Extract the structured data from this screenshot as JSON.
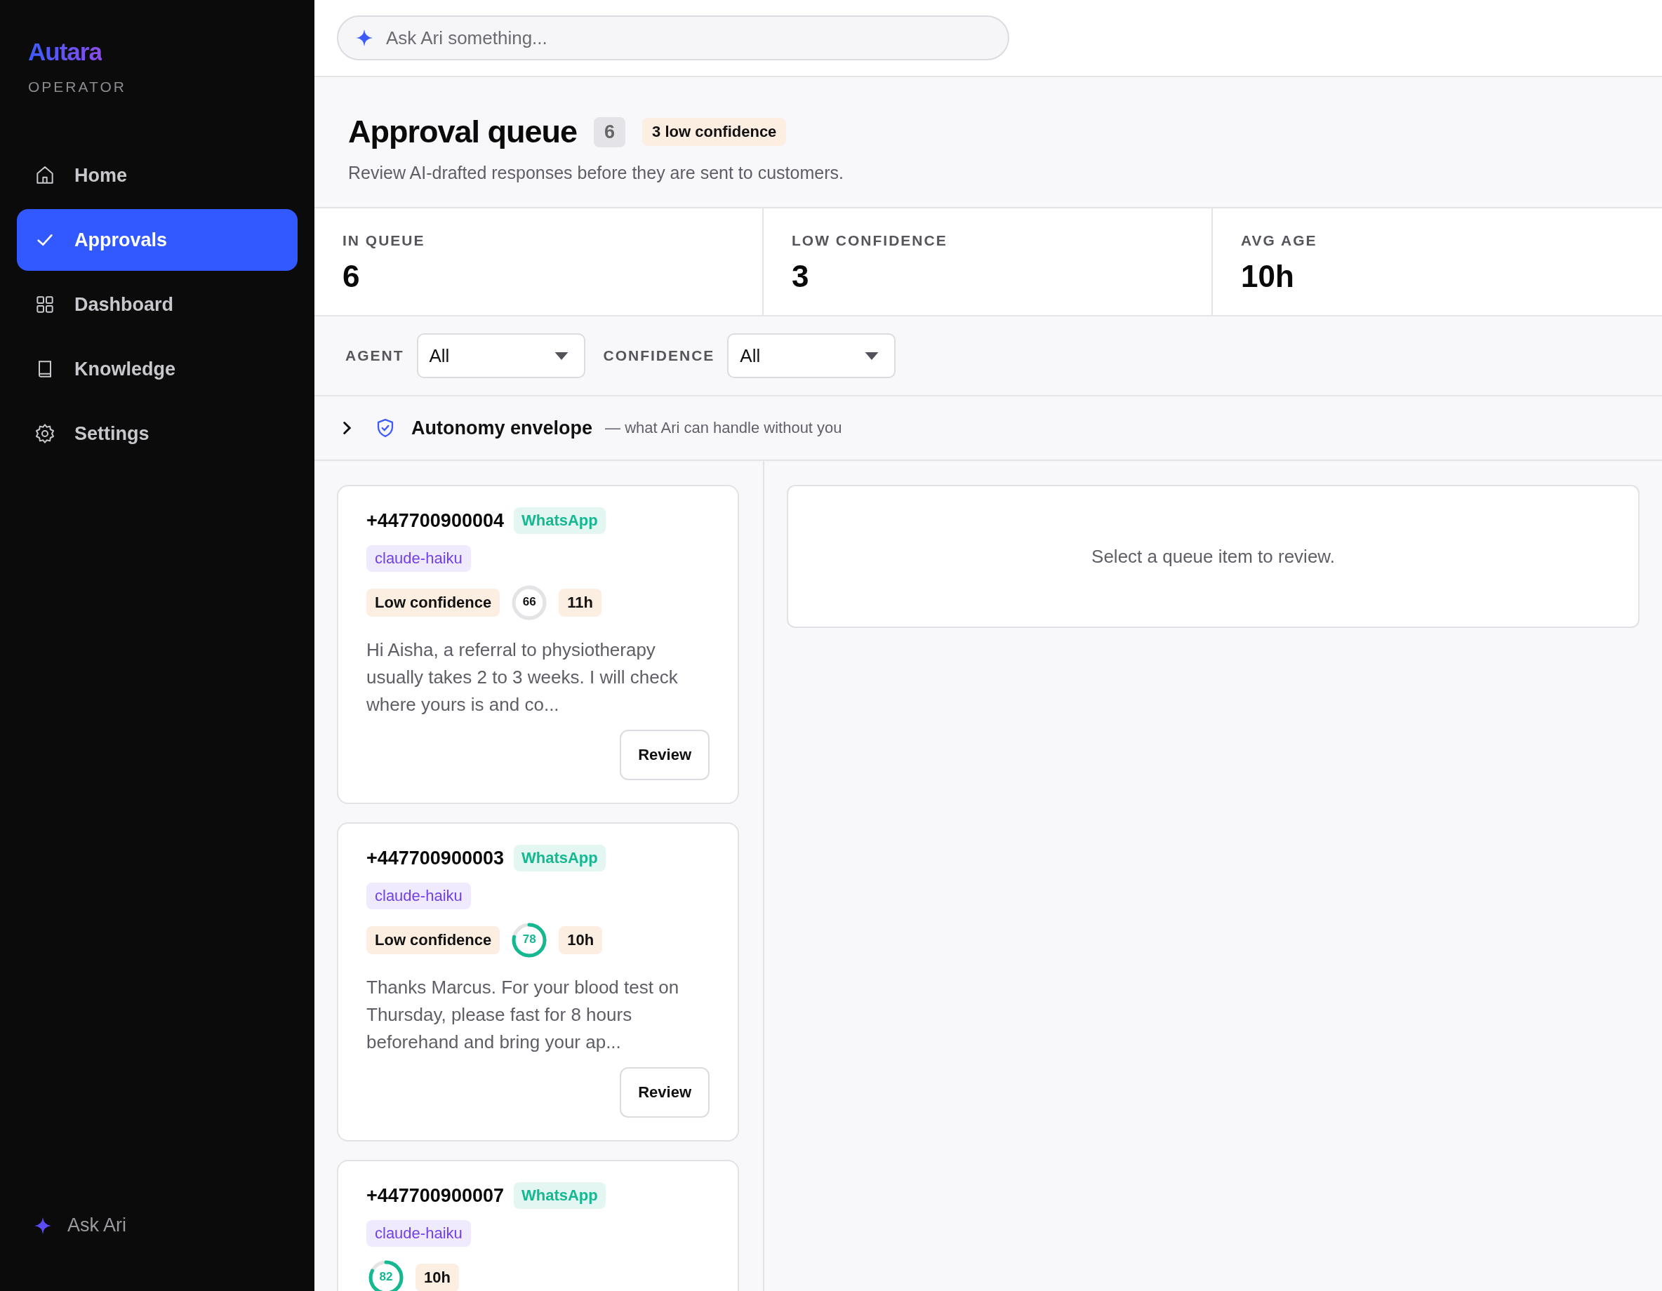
{
  "sidebar": {
    "brand": "Autara",
    "subtitle": "OPERATOR",
    "items": [
      {
        "label": "Home",
        "selected": false
      },
      {
        "label": "Approvals",
        "selected": true
      },
      {
        "label": "Dashboard",
        "selected": false
      },
      {
        "label": "Knowledge",
        "selected": false
      },
      {
        "label": "Settings",
        "selected": false
      }
    ],
    "footer": "Ask Ari"
  },
  "search": {
    "placeholder": "Ask Ari something..."
  },
  "header": {
    "title": "Approval queue",
    "count": "6",
    "badge": "3 low confidence",
    "subtitle": "Review AI-drafted responses before they are sent to customers."
  },
  "stats": [
    {
      "label": "IN QUEUE",
      "value": "6"
    },
    {
      "label": "LOW CONFIDENCE",
      "value": "3"
    },
    {
      "label": "AVG AGE",
      "value": "10h"
    }
  ],
  "filters": [
    {
      "label": "AGENT",
      "value": "All"
    },
    {
      "label": "CONFIDENCE",
      "value": "All"
    }
  ],
  "envelope": {
    "expanded": false,
    "title": "Autonomy envelope",
    "note": "— what Ari can handle without you"
  },
  "cards": [
    {
      "phone": "+447700900004",
      "channel": "WhatsApp",
      "model": "claude-haiku",
      "flag": "Low confidence",
      "score": "66",
      "color": "#e4e4e7",
      "age": "11h",
      "message": "Hi Aisha, a referral to physiotherapy usually takes 2 to 3 weeks. I will check where yours is and co...",
      "action": "Review"
    },
    {
      "phone": "+447700900003",
      "channel": "WhatsApp",
      "model": "claude-haiku",
      "flag": "Low confidence",
      "score": "78",
      "color": "#14b891",
      "age": "10h",
      "message": "Thanks Marcus. For your blood test on Thursday, please fast for 8 hours beforehand and bring your ap...",
      "action": "Review"
    },
    {
      "phone": "+447700900007",
      "channel": "WhatsApp",
      "model": "claude-haiku",
      "score": "82",
      "color": "#14b891",
      "age": "10h"
    }
  ],
  "detail": {
    "empty_text": "Select a queue item to review."
  }
}
